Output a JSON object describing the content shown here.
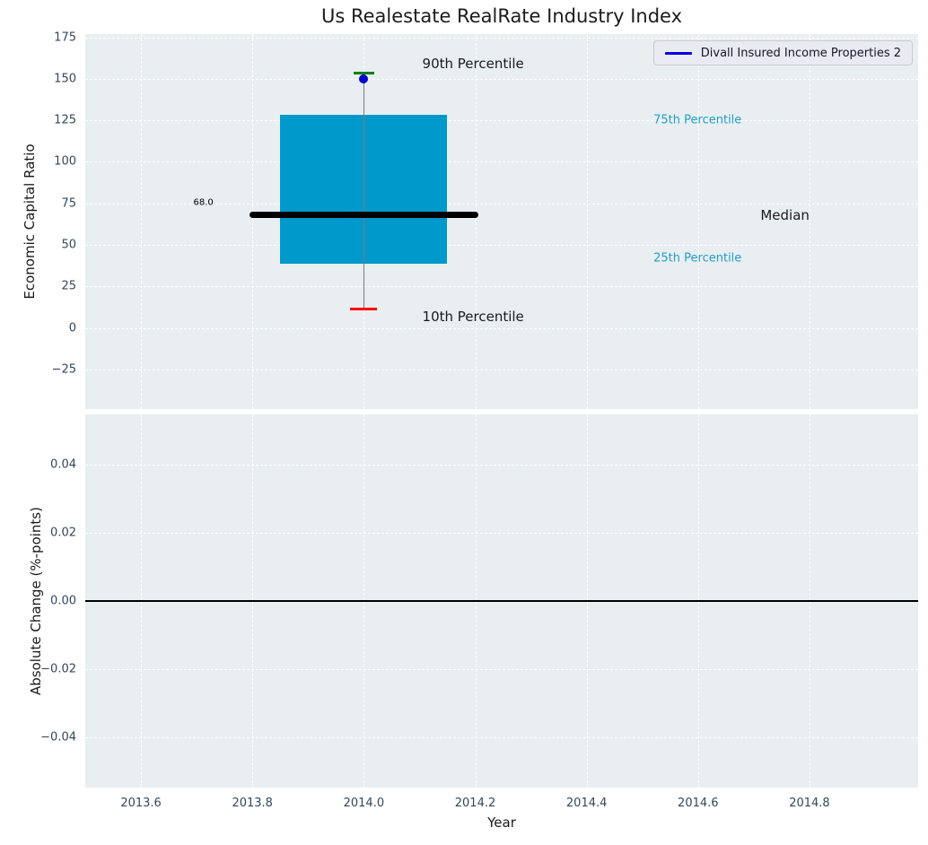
{
  "title": "Us Realestate RealRate Industry Index",
  "legend": {
    "label": "Divall Insured Income Properties 2",
    "line_color": "#0000dd",
    "position": "upper right"
  },
  "colors": {
    "axes_bg": "#e9eef0",
    "grid": "#ffffff",
    "tick_label": "#33475c",
    "text": "#1a1a1a",
    "box_fill": "#0099cb",
    "median": "#000000",
    "whisker": "#7a7a7a",
    "cap_90th": "#008000",
    "cap_10th": "#ff0000",
    "point": "#0000cd",
    "percentile_label": "#1e9ecd"
  },
  "chart_data": [
    {
      "type": "boxplot",
      "ylabel": "Economic Capital Ratio",
      "xlim": [
        2013.5,
        2014.995
      ],
      "ylim": [
        -48.75,
        176.9
      ],
      "xticks": [
        2013.6,
        2013.8,
        2014.0,
        2014.2,
        2014.4,
        2014.6,
        2014.8
      ],
      "yticks": [
        175,
        150,
        125,
        100,
        75,
        50,
        25,
        0,
        -25
      ],
      "yticklabels": [
        "175",
        "150",
        "125",
        "100",
        "75",
        "50",
        "25",
        "0",
        "−25"
      ],
      "grid": true,
      "box": {
        "x": 2014.0,
        "p10": 11.7,
        "q1": 38.5,
        "median": 68.0,
        "q3": 128.5,
        "p90": 153.5,
        "median_label": "68.0",
        "box_halfwidth": 0.15,
        "median_halfwidth": 0.205,
        "cap90_halfwidth": 0.0185,
        "cap10_halfwidth": 0.024
      },
      "series_point": {
        "name": "Divall Insured Income Properties 2",
        "x": 2014.0,
        "y": 150
      },
      "annotations": [
        {
          "text": "90th Percentile",
          "x": 2014.105,
          "y": 159,
          "size": 15,
          "color": "#1a1a1a",
          "align": "left"
        },
        {
          "text": "10th Percentile",
          "x": 2014.105,
          "y": 7,
          "size": 15,
          "color": "#1a1a1a",
          "align": "left"
        },
        {
          "text": "75th Percentile",
          "x": 2014.52,
          "y": 125,
          "size": 13,
          "color": "#1e9ecd",
          "align": "left"
        },
        {
          "text": "25th Percentile",
          "x": 2014.52,
          "y": 42,
          "size": 13,
          "color": "#1e9ecd",
          "align": "left"
        },
        {
          "text": "Median",
          "x": 2014.712,
          "y": 68,
          "size": 15,
          "color": "#1a1a1a",
          "align": "left"
        },
        {
          "text": "68.0",
          "x": 2013.73,
          "y": 75.5,
          "size": 10,
          "color": "#000000",
          "align": "right"
        }
      ]
    },
    {
      "type": "line",
      "ylabel": "Absolute Change (%-points)",
      "xlabel": "Year",
      "xlim": [
        2013.5,
        2014.995
      ],
      "ylim": [
        -0.0547,
        0.0547
      ],
      "xticks": [
        2013.6,
        2013.8,
        2014.0,
        2014.2,
        2014.4,
        2014.6,
        2014.8
      ],
      "xticklabels": [
        "2013.6",
        "2013.8",
        "2014.0",
        "2014.2",
        "2014.4",
        "2014.6",
        "2014.8"
      ],
      "yticks": [
        0.04,
        0.02,
        0.0,
        -0.02,
        -0.04
      ],
      "yticklabels": [
        "0.04",
        "0.02",
        "0.00",
        "−0.02",
        "−0.04"
      ],
      "grid": true,
      "zero_line": {
        "y": 0.0,
        "color": "#000000"
      }
    }
  ]
}
